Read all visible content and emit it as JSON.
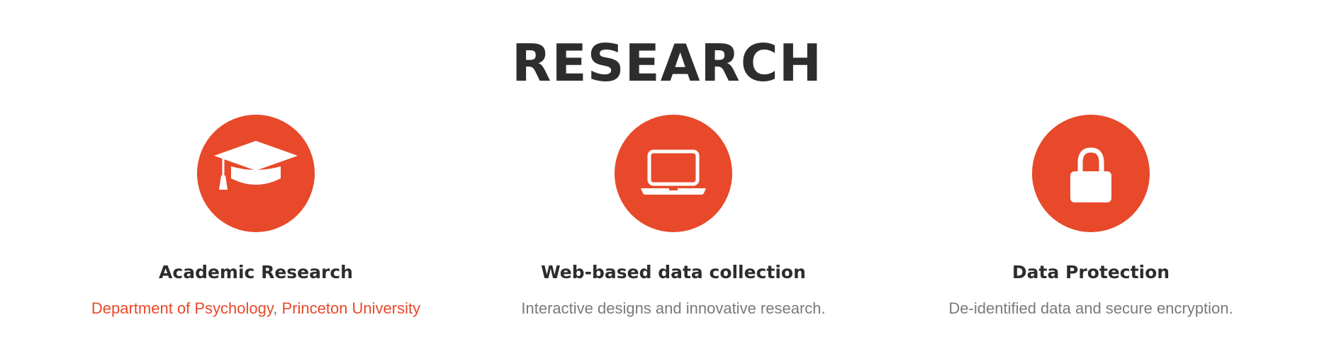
{
  "section": {
    "title": "RESEARCH"
  },
  "accent_color": "#e8492a",
  "features": [
    {
      "icon": "graduation-cap-icon",
      "title": "Academic Research",
      "link1": "Department of Psychology",
      "separator": ", ",
      "link2": "Princeton University"
    },
    {
      "icon": "laptop-icon",
      "title": "Web-based data collection",
      "description": "Interactive designs and innovative research."
    },
    {
      "icon": "lock-icon",
      "title": "Data Protection",
      "description": "De-identified data and secure encryption."
    }
  ]
}
